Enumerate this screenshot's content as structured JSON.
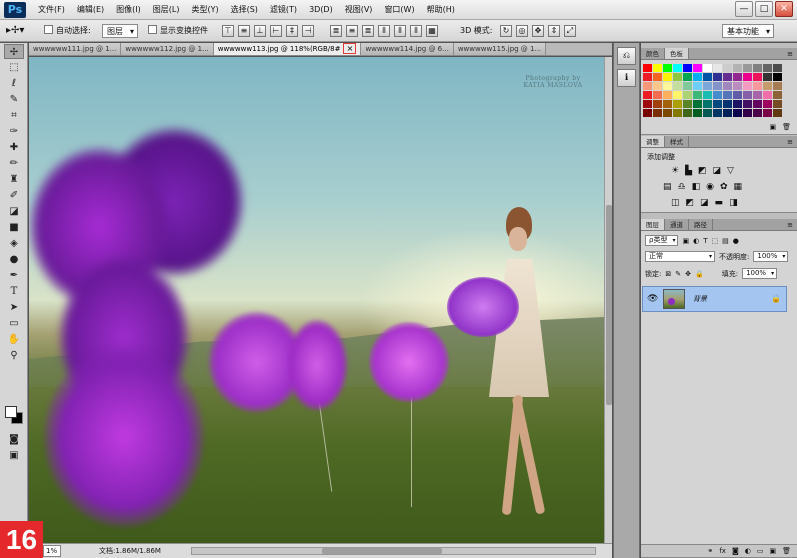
{
  "app": {
    "logo": "Ps"
  },
  "menu": [
    "文件(F)",
    "编辑(E)",
    "图像(I)",
    "图层(L)",
    "类型(Y)",
    "选择(S)",
    "滤镜(T)",
    "3D(D)",
    "视图(V)",
    "窗口(W)",
    "帮助(H)"
  ],
  "window_controls": {
    "minimize": "—",
    "restore": "□",
    "close": "✕"
  },
  "options": {
    "auto_select_label": "自动选择:",
    "auto_select_value": "图层",
    "transform_controls_label": "显示变换控件",
    "mode_3d_label": "3D 模式:",
    "workspace": "基本功能"
  },
  "tabs": [
    {
      "label": "wwwwww111.jpg @ 1..."
    },
    {
      "label": "wwwwww112.jpg @ 1..."
    },
    {
      "label": "wwwwww113.jpg @ 118%(RGB/8#",
      "active": true
    },
    {
      "label": "wwwwww114.jpg @ 6..."
    },
    {
      "label": "wwwwww115.jpg @ 1..."
    }
  ],
  "active_tab_close": "×",
  "watermark": {
    "line1": "Photography by",
    "line2": "KATIA MASLOVA"
  },
  "step_badge": "16",
  "status": {
    "zoom": "1%",
    "doc": "文档:1.86M/1.86M"
  },
  "panels": {
    "swatches": {
      "tabs": [
        "颜色",
        "色板"
      ]
    },
    "adjustments": {
      "tabs": [
        "调整",
        "样式"
      ],
      "title": "添加调整"
    },
    "layers": {
      "tabs": [
        "图层",
        "通道",
        "路径"
      ],
      "filter": "ρ类型",
      "blend_mode": "正常",
      "opacity_label": "不透明度:",
      "opacity": "100%",
      "lock_label": "锁定:",
      "fill_label": "填充:",
      "fill": "100%",
      "layer_name": "背景"
    }
  },
  "swatch_colors": [
    "#ff0000",
    "#ffff00",
    "#00ff00",
    "#00ffff",
    "#0000ff",
    "#ff00ff",
    "#ffffff",
    "#e6e6e6",
    "#cccccc",
    "#b3b3b3",
    "#999999",
    "#808080",
    "#666666",
    "#4d4d4d",
    "#ed1c24",
    "#f26522",
    "#fff200",
    "#8dc63f",
    "#00a651",
    "#00aeef",
    "#0054a6",
    "#2e3192",
    "#662d91",
    "#92278f",
    "#ec008c",
    "#ed145b",
    "#333333",
    "#000000",
    "#f7977a",
    "#fdc68a",
    "#fff799",
    "#c4df9b",
    "#82ca9c",
    "#6dcff6",
    "#7da7d9",
    "#8493ca",
    "#a187be",
    "#bd8cbf",
    "#f49ac1",
    "#f6989d",
    "#c69c6d",
    "#a67c52",
    "#ec1c24",
    "#f26c4f",
    "#fbaf5d",
    "#fff568",
    "#acd373",
    "#3cb878",
    "#1cbbb4",
    "#448ccb",
    "#5674b9",
    "#605ca8",
    "#855fa8",
    "#a864a8",
    "#f06eaa",
    "#8c6239",
    "#9e0b0f",
    "#a0410d",
    "#a36209",
    "#aba000",
    "#598527",
    "#007236",
    "#00746b",
    "#004a80",
    "#003471",
    "#1b1464",
    "#440e62",
    "#630460",
    "#9e005d",
    "#754c24",
    "#790000",
    "#7b2e00",
    "#7d4900",
    "#827b00",
    "#406618",
    "#005e20",
    "#005952",
    "#003663",
    "#002157",
    "#0d004c",
    "#32004b",
    "#4b0049",
    "#7b0046",
    "#603913"
  ]
}
